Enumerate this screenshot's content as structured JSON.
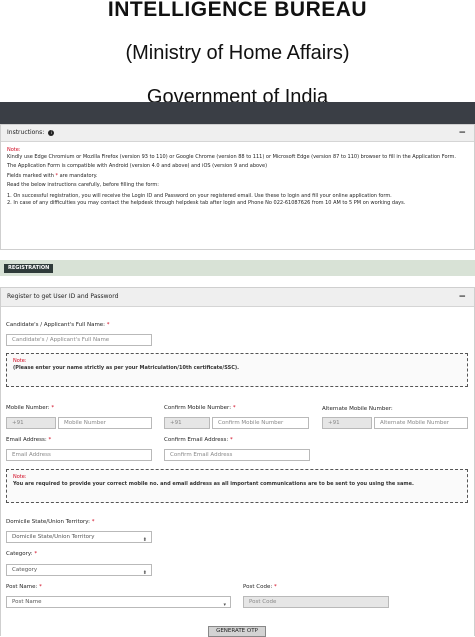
{
  "header": {
    "title": "INTELLIGENCE BUREAU",
    "subtitle": "(Ministry of Home Affairs)",
    "government": "Government of India"
  },
  "instructions": {
    "heading": "Instructions:",
    "info_icon": "info-icon",
    "note_label": "Note:",
    "line1": "Kindly use Edge Chromium or Mozilla Firefox (version 93 to 110) or Google Chrome (version 88 to 111) or Microsoft Edge (version 87 to 110) browser to fill in the Application Form.",
    "line2": "The Application Form is compatible with Android (version 4.0 and above) and iOS (version 9 and above)",
    "line3_pre": "Fields marked with ",
    "line3_star": "*",
    "line3_post": " are mandatory.",
    "line4": "Read the below instructions carefully, before filling the form:",
    "item1": "1. On successful registration, you will receive the Login ID and Password on your registered email. Use these to login and fill your online application form.",
    "item2": "2. In case of any difficulties you may contact the helpdesk through helpdesk tab after login and Phone No 022-61087626 from 10 AM to 5 PM on working days."
  },
  "registration_tab": "REGISTRATION",
  "register_panel": {
    "heading": "Register to get User ID and Password",
    "full_name_label": "Candidate's / Applicant's Full Name:",
    "full_name_placeholder": "Candidate's / Applicant's Full Name",
    "note1_label": "Note:",
    "note1_text": "(Please enter your name strictly as per your Matriculation/10th certificate/SSC).",
    "mobile_label": "Mobile Number:",
    "mobile_prefix": "+91",
    "mobile_placeholder": "Mobile Number",
    "confirm_mobile_label": "Confirm Mobile Number:",
    "confirm_mobile_prefix": "+91",
    "confirm_mobile_placeholder": "Confirm Mobile Number",
    "alt_mobile_label": "Alternate Mobile Number:",
    "alt_mobile_prefix": "+91",
    "alt_mobile_placeholder": "Alternate Mobile Number",
    "email_label": "Email Address:",
    "email_placeholder": "Email Address",
    "confirm_email_label": "Confirm Email Address:",
    "confirm_email_placeholder": "Confirm Email Address",
    "note2_label": "Note:",
    "note2_text": "You are required to provide your correct mobile no. and email address as all important communications are to be sent to you using the same.",
    "domicile_label": "Domicile State/Union Territory:",
    "domicile_value": "Domicile State/Union Territory",
    "category_label": "Category:",
    "category_value": "Category",
    "post_name_label": "Post Name:",
    "post_name_value": "Post Name",
    "post_code_label": "Post Code:",
    "post_code_placeholder": "Post Code",
    "star": "*",
    "generate_otp": "GENERATE OTP"
  }
}
